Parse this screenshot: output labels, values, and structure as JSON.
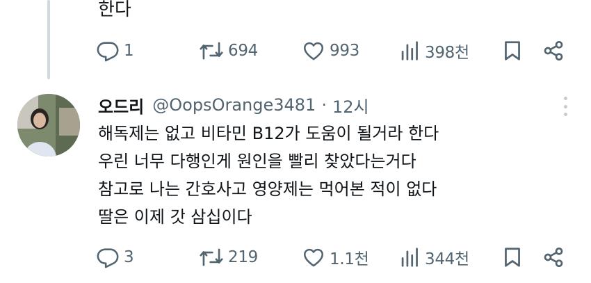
{
  "previous_tweet": {
    "text_tail": "한다",
    "actions": {
      "replies": "1",
      "retweets": "694",
      "likes": "993",
      "views": "398천"
    }
  },
  "tweet": {
    "display_name": "오드리",
    "handle": "@OopsOrange3481",
    "separator": "·",
    "time": "12시",
    "lines": [
      "해독제는 없고 비타민 B12가 도움이 될거라 한다",
      "우린 너무 다행인게 원인을 빨리 찾았다는거다",
      "참고로 나는 간호사고 영양제는 먹어본 적이 없다",
      "딸은 이제 갓 삼십이다"
    ],
    "actions": {
      "replies": "3",
      "retweets": "219",
      "likes": "1.1천",
      "views": "344천"
    }
  },
  "icons": {
    "reply": "reply-icon",
    "retweet": "retweet-icon",
    "like": "heart-icon",
    "views": "views-icon",
    "bookmark": "bookmark-icon",
    "share": "share-icon",
    "more": "more-icon"
  },
  "colors": {
    "text": "#0f1419",
    "secondary": "#536471",
    "thread_line": "#cfd9de"
  }
}
